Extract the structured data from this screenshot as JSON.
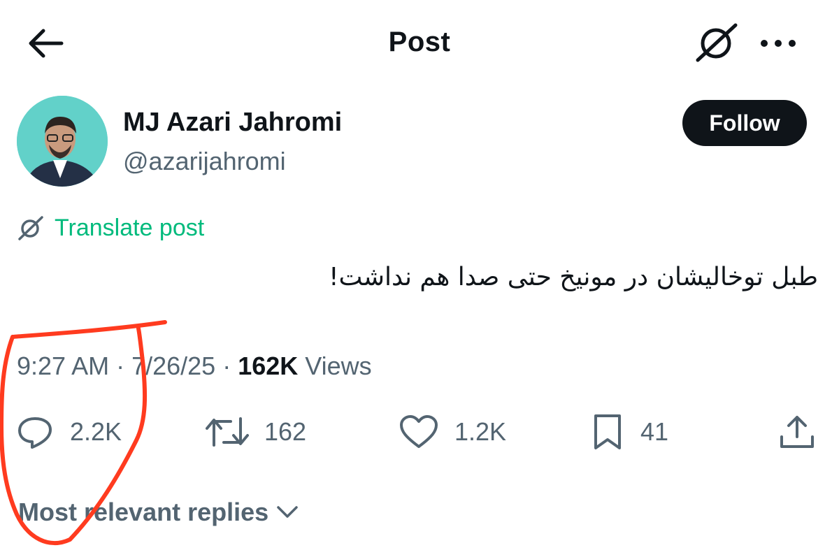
{
  "header": {
    "title": "Post",
    "back_icon": "arrow-left-icon",
    "grok_icon": "grok-icon",
    "more_icon": "more-dots-icon"
  },
  "author": {
    "name": "MJ Azari Jahromi",
    "handle": "@azarijahromi",
    "follow_label": "Follow"
  },
  "translate": {
    "label": "Translate post",
    "color": "#00ba7c"
  },
  "post": {
    "text": "طبل توخالیشان در مونیخ حتی صدا هم نداشت!"
  },
  "meta": {
    "time": "9:27 AM",
    "date": "7/26/25",
    "views_count": "162K",
    "views_label": "Views"
  },
  "actions": {
    "replies": "2.2K",
    "reposts": "162",
    "likes": "1.2K",
    "bookmarks": "41"
  },
  "replies_sort": {
    "label": "Most relevant replies"
  },
  "colors": {
    "text_primary": "#0f1419",
    "text_secondary": "#536471",
    "annotation": "#ff3b1f"
  }
}
